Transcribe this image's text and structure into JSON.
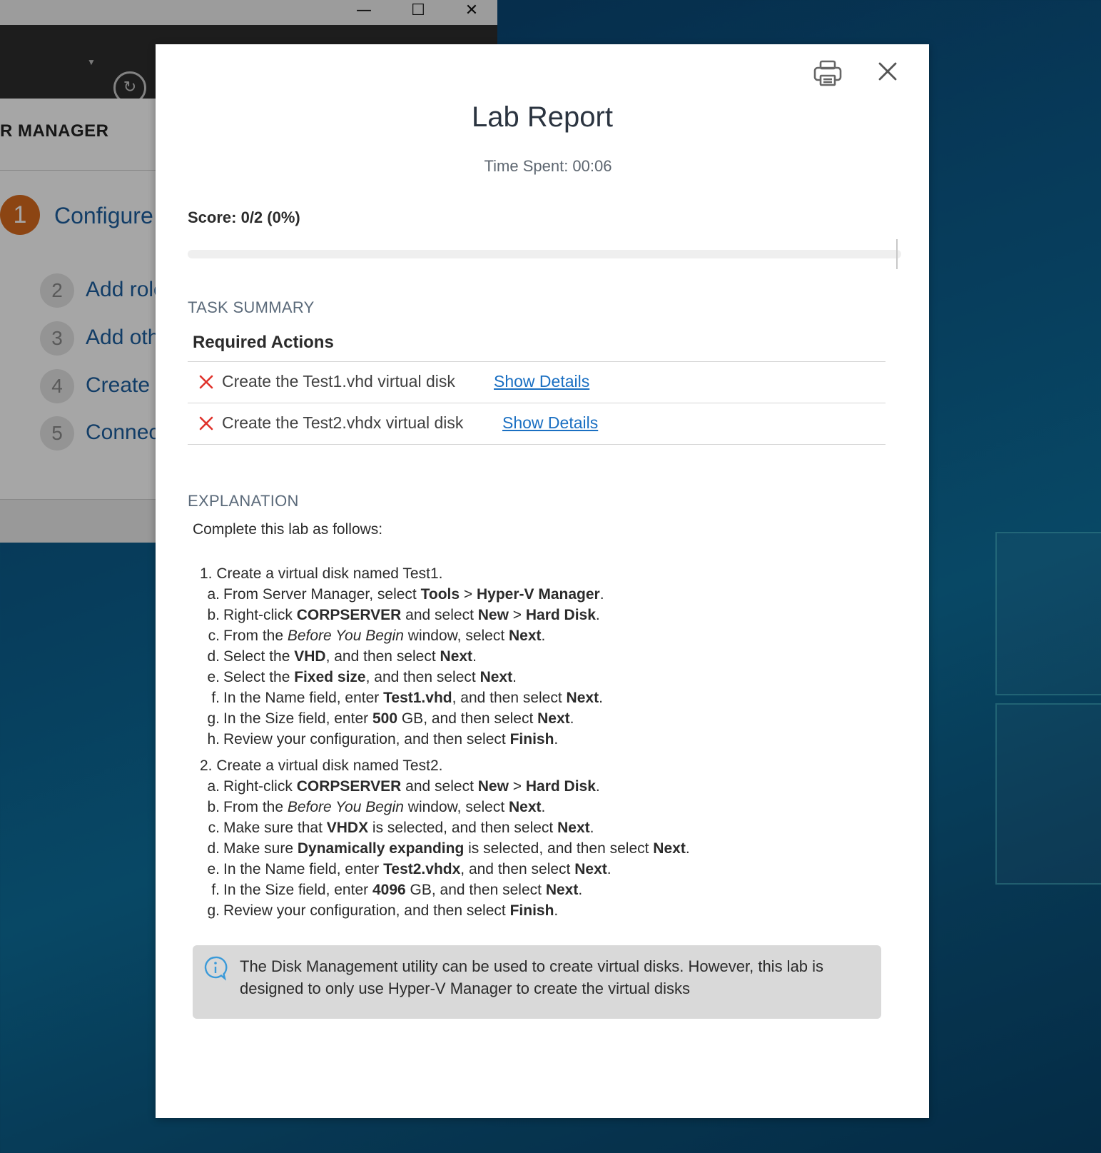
{
  "background_window": {
    "title_partial": "R MANAGER",
    "window_controls": {
      "minimize": "—",
      "maximize": "☐",
      "close": "✕"
    },
    "steps": [
      {
        "num": "1",
        "label": "Configure"
      },
      {
        "num": "2",
        "label": "Add role"
      },
      {
        "num": "3",
        "label": "Add othe"
      },
      {
        "num": "4",
        "label": "Create a"
      },
      {
        "num": "5",
        "label": "Connect"
      }
    ]
  },
  "modal": {
    "title": "Lab Report",
    "time_spent": "Time Spent: 00:06",
    "score": "Score: 0/2 (0%)",
    "progress_fraction": 0.0,
    "icons": {
      "print": "printer-icon",
      "close": "close-icon"
    },
    "task_summary_label": "TASK SUMMARY",
    "required_actions_label": "Required Actions",
    "tasks": [
      {
        "status": "failed",
        "text": "Create the Test1.vhd virtual disk",
        "link": "Show Details"
      },
      {
        "status": "failed",
        "text": "Create the Test2.vhdx virtual disk",
        "link": "Show Details"
      }
    ],
    "explanation_label": "EXPLANATION",
    "explanation_intro": "Complete this lab as follows:",
    "steps": [
      {
        "num": "1.",
        "text": "Create a virtual disk named Test1.",
        "subs": [
          {
            "letter": "a.",
            "parts": [
              "From Server Manager, select ",
              "Tools",
              " > ",
              "Hyper-V Manager",
              "."
            ]
          },
          {
            "letter": "b.",
            "parts": [
              "Right-click ",
              "CORPSERVER",
              " and select ",
              "New",
              " > ",
              "Hard Disk",
              "."
            ]
          },
          {
            "letter": "c.",
            "parts": [
              "From the ",
              "Before You Begin",
              " window, select ",
              "Next",
              "."
            ]
          },
          {
            "letter": "d.",
            "parts": [
              "Select the ",
              "VHD",
              ", and then select ",
              "Next",
              "."
            ]
          },
          {
            "letter": "e.",
            "parts": [
              "Select the ",
              "Fixed size",
              ", and then select ",
              "Next",
              "."
            ]
          },
          {
            "letter": "f.",
            "parts": [
              "In the Name field, enter ",
              "Test1.vhd",
              ", and then select ",
              "Next",
              "."
            ]
          },
          {
            "letter": "g.",
            "parts": [
              "In the Size field, enter ",
              "500",
              " GB, and then select ",
              "Next",
              "."
            ]
          },
          {
            "letter": "h.",
            "parts": [
              "Review your configuration, and then select ",
              "Finish",
              "."
            ]
          }
        ]
      },
      {
        "num": "2.",
        "text": "Create a virtual disk named Test2.",
        "subs": [
          {
            "letter": "a.",
            "parts": [
              "Right-click ",
              "CORPSERVER",
              " and select ",
              "New",
              " > ",
              "Hard Disk",
              "."
            ]
          },
          {
            "letter": "b.",
            "parts": [
              "From the ",
              "Before You Begin",
              " window, select ",
              "Next",
              "."
            ]
          },
          {
            "letter": "c.",
            "parts": [
              "Make sure that ",
              "VHDX",
              " is selected, and then select ",
              "Next",
              "."
            ]
          },
          {
            "letter": "d.",
            "parts": [
              "Make sure ",
              "Dynamically expanding",
              " is selected, and then select ",
              "Next",
              "."
            ]
          },
          {
            "letter": "e.",
            "parts": [
              "In the Name field, enter ",
              "Test2.vhdx",
              ", and then select ",
              "Next",
              "."
            ]
          },
          {
            "letter": "f.",
            "parts": [
              "In the Size field, enter ",
              "4096",
              " GB, and then select ",
              "Next",
              "."
            ]
          },
          {
            "letter": "g.",
            "parts": [
              "Review your configuration, and then select ",
              "Finish",
              "."
            ]
          }
        ]
      }
    ],
    "note": {
      "icon": "info-icon",
      "text": "The Disk Management utility can be used to create virtual disks. However, this lab is designed to only use Hyper-V Manager to create the virtual disks"
    },
    "colors": {
      "fail_x": "#e0322b",
      "link": "#1a6fc2",
      "info_icon": "#3a9ad9",
      "step1_accent": "#d86a1e"
    }
  }
}
